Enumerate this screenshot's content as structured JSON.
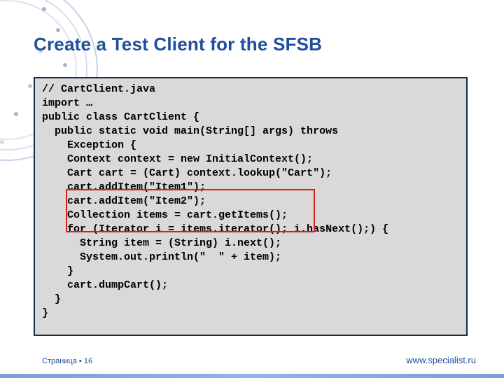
{
  "title": "Create a Test Client for the SFSB",
  "code": {
    "l01": "// CartClient.java",
    "l02": "import …",
    "l03": "public class CartClient {",
    "l04": "  public static void main(String[] args) throws",
    "l05": "    Exception {",
    "l06": "    Context context = new InitialContext();",
    "l07": "    Cart cart = (Cart) context.lookup(\"Cart\");",
    "l08": "    cart.addItem(\"Item1\");",
    "l09": "    cart.addItem(\"Item2\");",
    "l10": "    Collection items = cart.getItems();",
    "l11": "    for (Iterator i = items.iterator(); i.hasNext();) {",
    "l12": "      String item = (String) i.next();",
    "l13": "      System.out.println(\"  \" + item);",
    "l14": "    }",
    "l15": "    cart.dumpCart();",
    "l16": "  }",
    "l17": "}"
  },
  "footer": {
    "page_label": "Страница ",
    "bullet": "▪",
    "page_number": "16",
    "site": "www.specialist.ru"
  },
  "colors": {
    "accent": "#1f4e9b",
    "callout": "#d6201e",
    "code_bg": "#d9d9d9"
  }
}
